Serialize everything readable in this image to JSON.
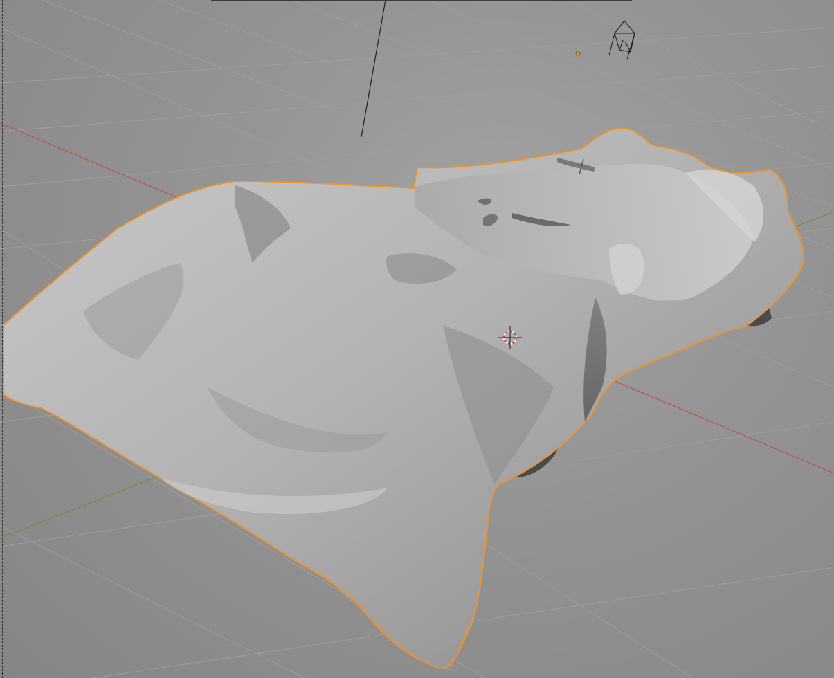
{
  "app": {
    "name": "",
    "view": "3D Viewport"
  },
  "viewport": {
    "shading": "solid",
    "background_color": "#939393",
    "grid_color": "#9e9e9e",
    "grid_visible": true,
    "x_axis_color": "#c24d4d",
    "y_axis_color": "#6b8f3a"
  },
  "scene": {
    "selected_object": {
      "name": "",
      "kind": "cloth-mesh",
      "outline_color": "#f0922b",
      "surface_color": "#b5b5b5"
    },
    "light": {
      "kind": "point-light",
      "color": "#f0922b"
    },
    "camera": {
      "kind": "camera"
    },
    "cursor": {
      "kind": "3d-cursor",
      "color": "#d63a3a"
    }
  }
}
